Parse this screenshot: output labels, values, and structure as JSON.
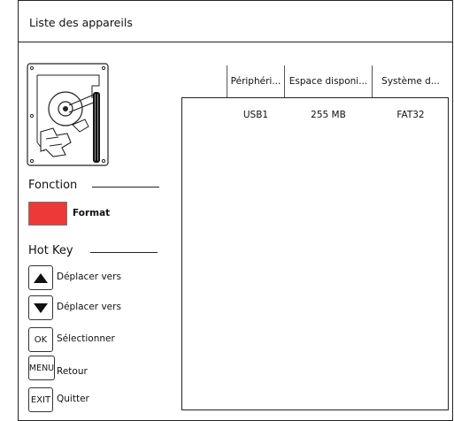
{
  "window": {
    "title": "Liste des appareils"
  },
  "left_panel": {
    "device_icon": "hard-disk-icon",
    "fonction": {
      "label": "Fonction",
      "format_button": {
        "color": "#ee3a36",
        "label": "Format"
      }
    },
    "hotkeys": {
      "label": "Hot Key",
      "items": [
        {
          "key_icon": "arrow-up-icon",
          "key_label": "",
          "action": "Déplacer vers"
        },
        {
          "key_icon": "arrow-down-icon",
          "key_label": "",
          "action": "Déplacer vers"
        },
        {
          "key_icon": "",
          "key_label": "OK",
          "action": "Sélectionner"
        },
        {
          "key_icon": "",
          "key_label": "MENU",
          "action": "Retour"
        },
        {
          "key_icon": "",
          "key_label": "EXIT",
          "action": "Quitter"
        }
      ]
    }
  },
  "device_table": {
    "columns": [
      "Périphéri...",
      "Espace disponi...",
      "Système d..."
    ],
    "rows": [
      [
        "USB1",
        "255 MB",
        "FAT32"
      ]
    ]
  }
}
